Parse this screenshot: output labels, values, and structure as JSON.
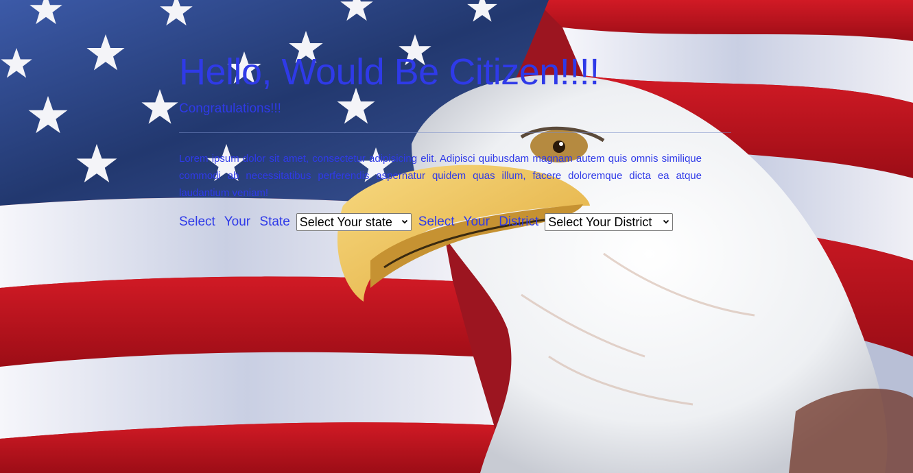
{
  "hero": {
    "title": "Hello, Would Be Citizen!!!!",
    "subtitle": "Congratulations!!!",
    "body": "Lorem ipsum dolor sit amet, consectetur adipisicing elit. Adipisci quibusdam magnam autem quis omnis similique commodi ab necessitatibus perferendis aspernatur quidem quas illum, facere doloremque dicta ea atque laudantium veniam!"
  },
  "form": {
    "state_label": "Select Your State",
    "state_selected": "Select Your state",
    "district_label": "Select Your District",
    "district_selected": "Select Your District"
  },
  "background": {
    "subject": "american-flag-with-bald-eagle"
  },
  "colors": {
    "text": "#2f3ae8",
    "flag_blue": "#2f4a8f",
    "flag_red": "#c01622",
    "flag_white": "#f2f2f6"
  }
}
